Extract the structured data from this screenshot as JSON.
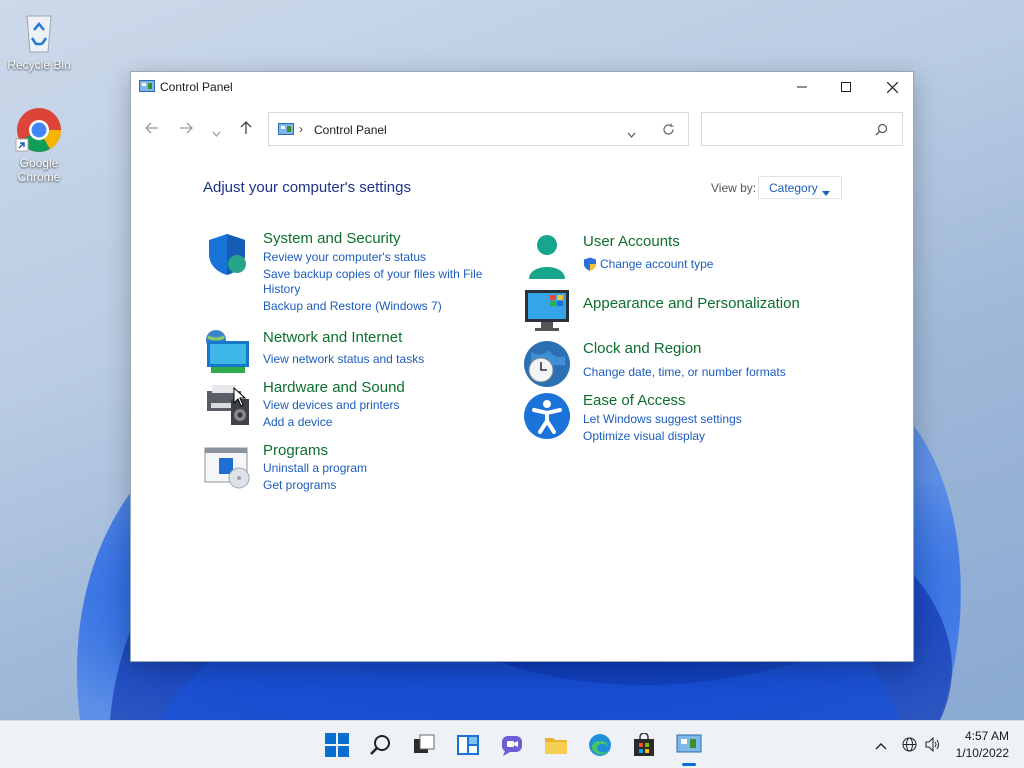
{
  "desktop": {
    "icons": [
      {
        "label": "Recycle Bin"
      },
      {
        "label": "Google Chrome"
      }
    ]
  },
  "window": {
    "title": "Control Panel",
    "address": {
      "crumb": "Control Panel"
    },
    "search": {
      "placeholder": ""
    },
    "heading": "Adjust your computer's settings",
    "view_by": {
      "label": "View by:",
      "value": "Category"
    },
    "categories_left": [
      {
        "title": "System and Security",
        "icon": "shield-icon",
        "links": [
          "Review your computer's status",
          "Save backup copies of your files with File",
          "History",
          "Backup and Restore (Windows 7)"
        ]
      },
      {
        "title": "Network and Internet",
        "icon": "network-icon",
        "links": [
          "View network status and tasks"
        ]
      },
      {
        "title": "Hardware and Sound",
        "icon": "printer-icon",
        "links": [
          "View devices and printers",
          "Add a device"
        ]
      },
      {
        "title": "Programs",
        "icon": "programs-icon",
        "links": [
          "Uninstall a program",
          "Get programs"
        ]
      }
    ],
    "categories_right": [
      {
        "title": "User Accounts",
        "icon": "user-icon",
        "links": [
          "Change account type"
        ]
      },
      {
        "title": "Appearance and Personalization",
        "icon": "monitor-icon",
        "links": []
      },
      {
        "title": "Clock and Region",
        "icon": "clock-globe-icon",
        "links": [
          "Change date, time, or number formats"
        ]
      },
      {
        "title": "Ease of Access",
        "icon": "accessibility-icon",
        "links": [
          "Let Windows suggest settings",
          "Optimize visual display"
        ]
      }
    ]
  },
  "taskbar": {
    "time": "4:57 AM",
    "date": "1/10/2022"
  },
  "colors": {
    "link": "#1c5dbd",
    "category_title": "#0c6f2e",
    "heading": "#1e3287"
  }
}
